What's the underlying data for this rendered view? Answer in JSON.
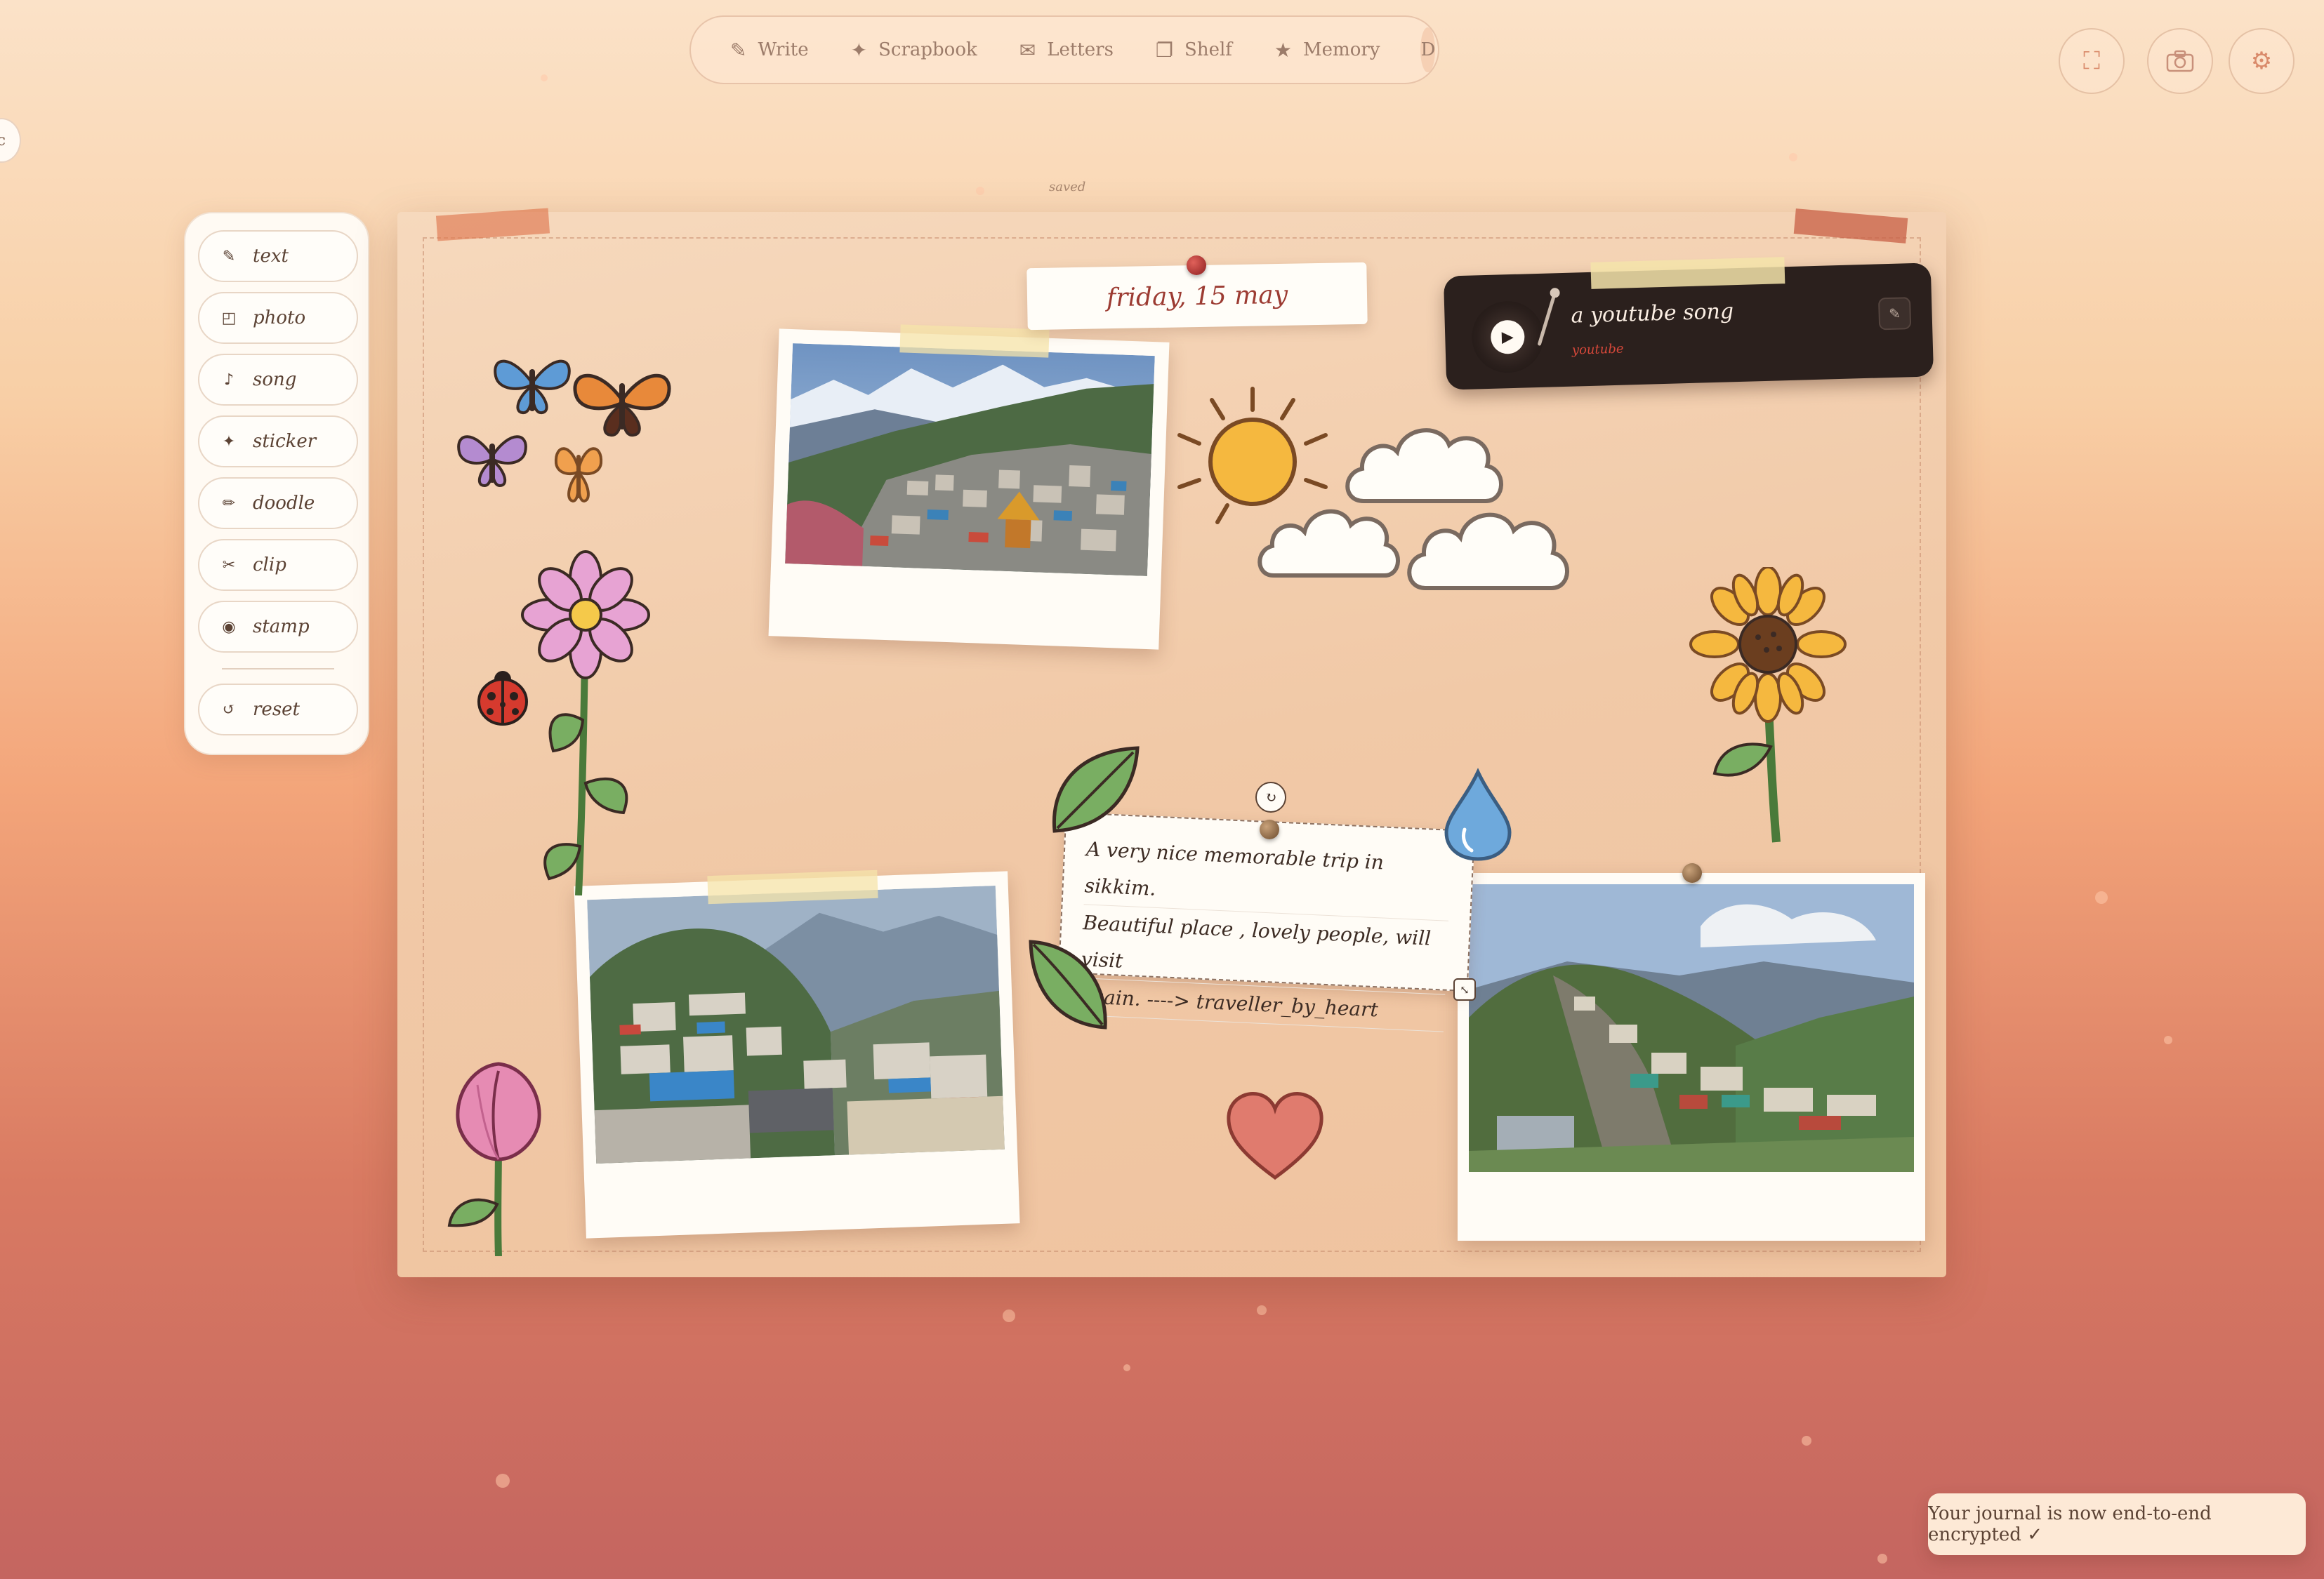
{
  "nav": {
    "items": [
      {
        "label": "Write",
        "icon": "pencil-icon",
        "glyph": "✎"
      },
      {
        "label": "Scrapbook",
        "icon": "sparkle-icon",
        "glyph": "✦"
      },
      {
        "label": "Letters",
        "icon": "envelope-icon",
        "glyph": "✉"
      },
      {
        "label": "Shelf",
        "icon": "book-icon",
        "glyph": "❐"
      },
      {
        "label": "Memory",
        "icon": "star-icon",
        "glyph": "★"
      }
    ],
    "avatar": "D"
  },
  "corner_buttons": {
    "fullscreen": {
      "icon": "fullscreen-icon",
      "glyph": "⛶"
    },
    "camera": {
      "icon": "camera-icon",
      "glyph": "⌷"
    },
    "settings": {
      "icon": "gear-icon",
      "glyph": "⚙"
    }
  },
  "edge_glyph": "c",
  "status": {
    "saved": "saved"
  },
  "tools": [
    {
      "label": "text",
      "glyph": "✎"
    },
    {
      "label": "photo",
      "glyph": "◰"
    },
    {
      "label": "song",
      "glyph": "♪"
    },
    {
      "label": "sticker",
      "glyph": "✦"
    },
    {
      "label": "doodle",
      "glyph": "✏"
    },
    {
      "label": "clip",
      "glyph": "✂"
    },
    {
      "label": "stamp",
      "glyph": "◉"
    }
  ],
  "reset": {
    "label": "reset",
    "glyph": "↺"
  },
  "board": {
    "date": "friday, 15 may",
    "song": {
      "title": "a youtube song",
      "source": "youtube",
      "play_glyph": "▶",
      "edit_glyph": "✎"
    },
    "note": {
      "lines": [
        "A very nice memorable trip in sikkim.",
        "Beautiful place , lovely people, will visit",
        "again. ----> traveller_by_heart"
      ],
      "rotate_glyph": "↻",
      "resize_glyph": "⤡"
    }
  },
  "toast": "Your journal is now end-to-end encrypted ✓",
  "colors": {
    "accent": "#9c3b32",
    "player_bg": "#2b201d",
    "board_bg": "#f1c9a7",
    "toast_bg": "#fde9d6"
  }
}
